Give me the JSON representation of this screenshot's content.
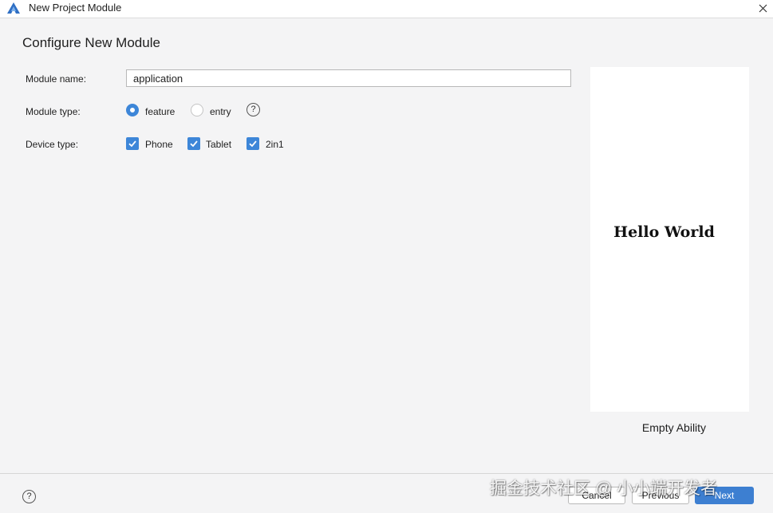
{
  "window": {
    "title": "New Project Module"
  },
  "page": {
    "heading": "Configure New Module"
  },
  "form": {
    "module_name_label": "Module name:",
    "module_name_value": "application",
    "module_type_label": "Module type:",
    "module_type_options": [
      {
        "label": "feature",
        "selected": true
      },
      {
        "label": "entry",
        "selected": false
      }
    ],
    "help_symbol": "?",
    "device_type_label": "Device type:",
    "device_types": [
      {
        "label": "Phone",
        "checked": true
      },
      {
        "label": "Tablet",
        "checked": true
      },
      {
        "label": "2in1",
        "checked": true
      }
    ]
  },
  "preview": {
    "text": "Hello World",
    "template_name": "Empty Ability"
  },
  "footer": {
    "help_symbol": "?",
    "cancel_label": "Cancel",
    "previous_label": "Previous",
    "next_label": "Next"
  },
  "watermark": {
    "text": "掘金技术社区 @ 小小端开发者"
  },
  "colors": {
    "accent": "#3d86d8",
    "primary_button": "#3d7fd1",
    "background": "#f4f4f5"
  },
  "icons": {
    "app_logo": "app-logo-icon",
    "close": "close-icon",
    "help": "help-icon",
    "check": "check-icon"
  }
}
